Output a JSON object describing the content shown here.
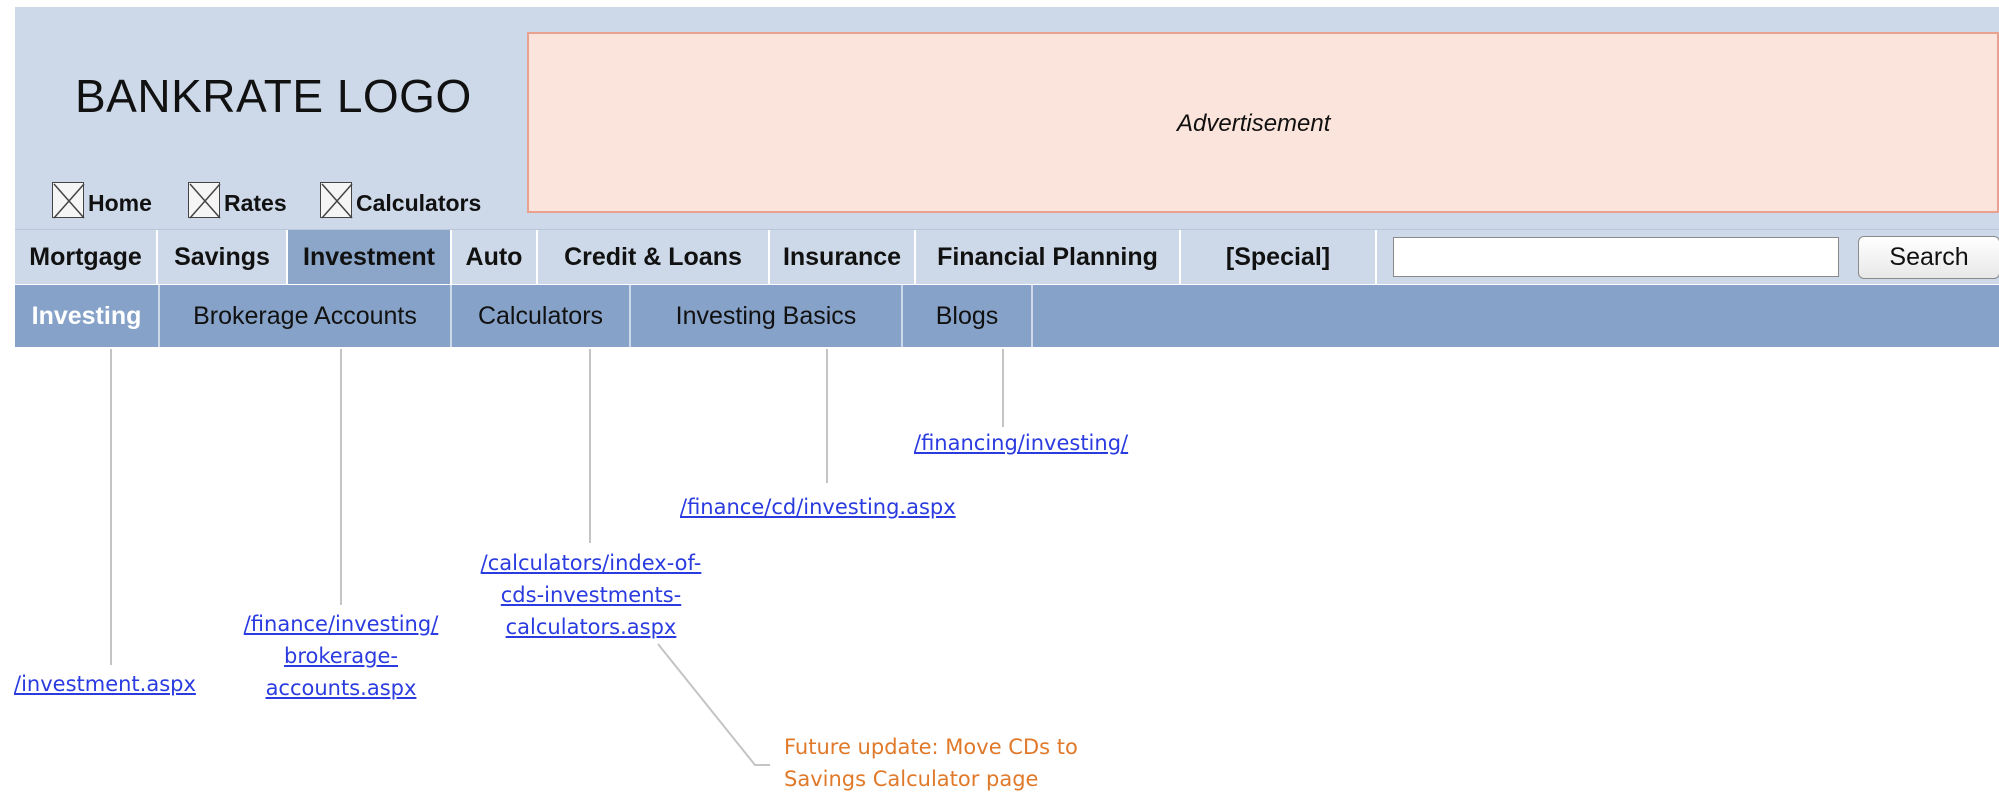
{
  "header": {
    "logo_text": "BANKRATE LOGO",
    "quick_links": [
      {
        "label": "Home",
        "icon": "broken-image-icon"
      },
      {
        "label": "Rates",
        "icon": "broken-image-icon"
      },
      {
        "label": "Calculators",
        "icon": "broken-image-icon"
      }
    ],
    "advertisement_label": "Advertisement"
  },
  "main_nav": {
    "items": [
      "Mortgage",
      "Savings",
      "Investment",
      "Auto",
      "Credit & Loans",
      "Insurance",
      "Financial Planning",
      "[Special]"
    ],
    "active": "Investment",
    "search": {
      "value": "",
      "placeholder": "",
      "button_label": "Search"
    }
  },
  "sub_nav": {
    "items": [
      "Investing",
      "Brokerage Accounts",
      "Calculators",
      "Investing Basics",
      "Blogs"
    ],
    "active": "Investing"
  },
  "annotations": {
    "investing_url": "/investment.aspx",
    "brokerage_url": [
      "/finance/investing/",
      "brokerage-",
      "accounts.aspx"
    ],
    "calculators_url": [
      "/calculators/index-of-",
      "cds-investments-",
      "calculators.aspx"
    ],
    "basics_url": "/finance/cd/investing.aspx",
    "blogs_url": "/financing/investing/",
    "future_note": [
      "Future update: Move CDs to",
      "Savings Calculator page"
    ]
  },
  "colors": {
    "header_bg": "#cdd9e8",
    "active_nav_bg": "#8ba6c9",
    "subnav_bg": "#86a2c8",
    "ad_bg": "#fbe4db",
    "ad_border": "#e9a190",
    "link": "#2a3be0",
    "note": "#e07a2a"
  }
}
